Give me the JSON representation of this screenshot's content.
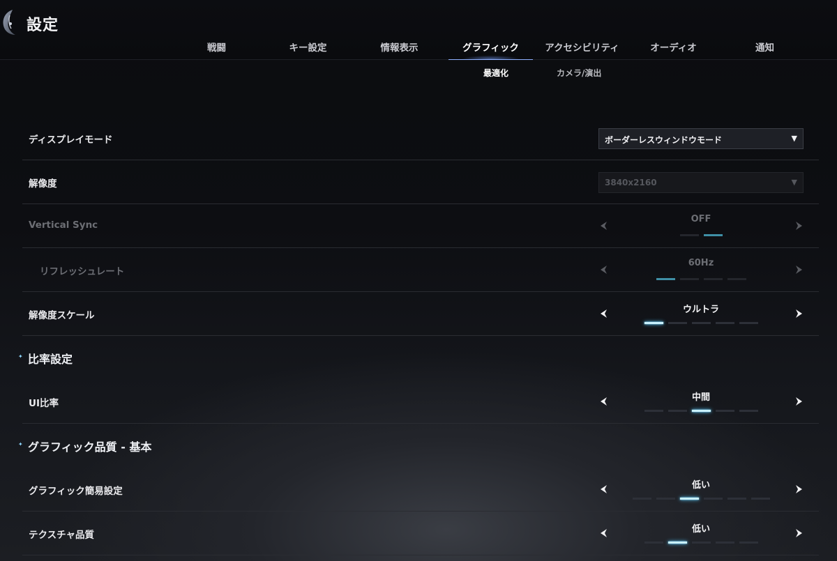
{
  "header": {
    "title": "設定"
  },
  "tabs": [
    {
      "label": "戦闘",
      "active": false
    },
    {
      "label": "キー設定",
      "active": false
    },
    {
      "label": "情報表示",
      "active": false
    },
    {
      "label": "グラフィック",
      "active": true
    },
    {
      "label": "アクセシビリティ",
      "active": false
    },
    {
      "label": "オーディオ",
      "active": false
    },
    {
      "label": "通知",
      "active": false
    }
  ],
  "subtabs": [
    {
      "label": "最適化",
      "active": true
    },
    {
      "label": "カメラ/演出",
      "active": false
    }
  ],
  "settings": {
    "display_mode": {
      "label": "ディスプレイモード",
      "value": "ボーダーレスウィンドウモード"
    },
    "resolution": {
      "label": "解像度",
      "value": "3840x2160"
    },
    "vsync": {
      "label": "Vertical Sync",
      "value": "OFF"
    },
    "refresh_rate": {
      "label": "リフレッシュレート",
      "value": "60Hz"
    },
    "resolution_scale": {
      "label": "解像度スケール",
      "value": "ウルトラ"
    },
    "ratio_section": {
      "label": "比率設定"
    },
    "ui_ratio": {
      "label": "UI比率",
      "value": "中間"
    },
    "graphics_section": {
      "label": "グラフィック品質 - 基本"
    },
    "graphics_preset": {
      "label": "グラフィック簡易設定",
      "value": "低い"
    },
    "texture_quality": {
      "label": "テクスチャ品質",
      "value": "低い"
    }
  },
  "steppers": {
    "vsync": {
      "count": 2,
      "selected": 2
    },
    "refresh_rate": {
      "count": 4,
      "selected": 1
    },
    "resolution_scale": {
      "count": 5,
      "selected": 1
    },
    "ui_ratio": {
      "count": 5,
      "selected": 3
    },
    "graphics_preset": {
      "count": 6,
      "selected": 3
    },
    "texture_quality": {
      "count": 5,
      "selected": 2
    }
  },
  "colors": {
    "accent_glow": "#4fc7ff",
    "tab_underline": "#8fb0ff",
    "background": "#0b0c0f"
  },
  "icons": {
    "logo": "game-emblem-icon",
    "caret": "dropdown-caret-icon",
    "left": "chevron-left-icon",
    "right": "chevron-right-icon",
    "section": "sparkle-icon"
  }
}
